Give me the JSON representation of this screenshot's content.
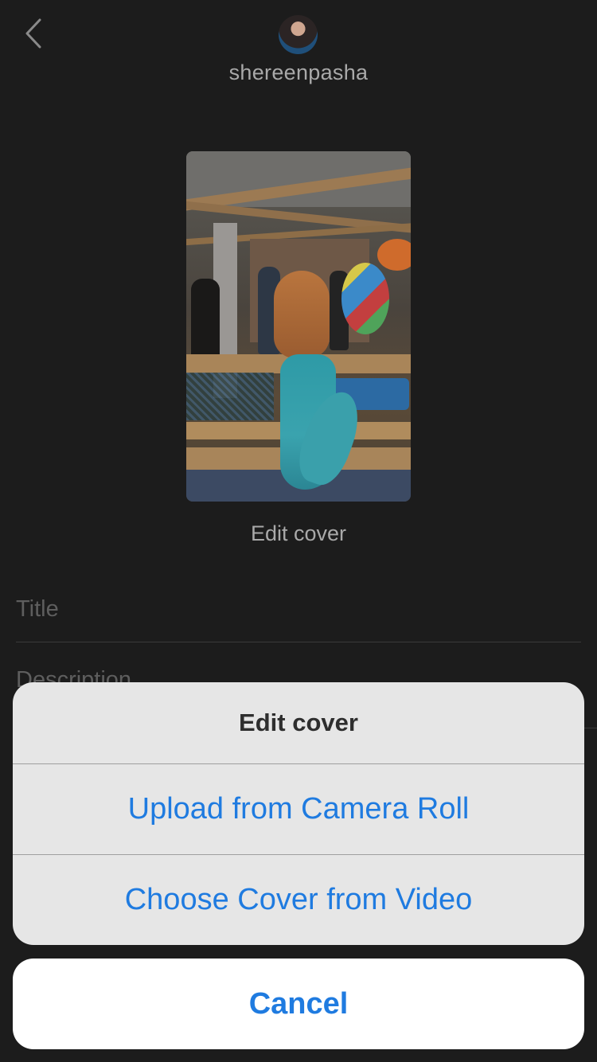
{
  "header": {
    "username": "shereenpasha",
    "back_icon": "chevron-left-icon"
  },
  "cover": {
    "edit_cover_label": "Edit cover"
  },
  "form": {
    "title_placeholder": "Title",
    "description_placeholder": "Description"
  },
  "action_sheet": {
    "title": "Edit cover",
    "actions": [
      {
        "label": "Upload from Camera Roll"
      },
      {
        "label": "Choose Cover from Video"
      }
    ],
    "cancel_label": "Cancel",
    "accent_color": "#1f7be0"
  }
}
